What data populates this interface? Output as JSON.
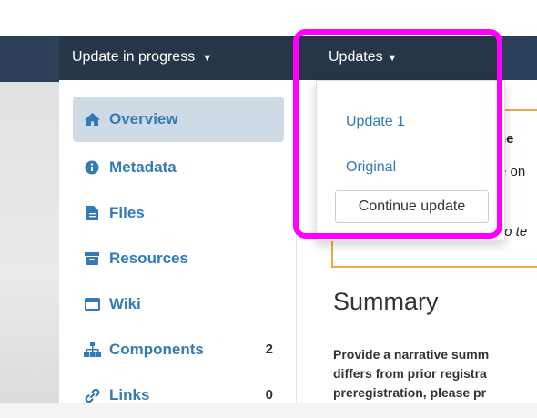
{
  "navbar": {
    "status_dropdown": "Update in progress",
    "updates_dropdown": "Updates"
  },
  "updates_menu": {
    "items": [
      "Update 1",
      "Original"
    ],
    "continue_button": "Continue update"
  },
  "sidebar": {
    "items": [
      {
        "label": "Overview",
        "icon": "home-icon",
        "active": true
      },
      {
        "label": "Metadata",
        "icon": "info-circle-icon"
      },
      {
        "label": "Files",
        "icon": "file-icon"
      },
      {
        "label": "Resources",
        "icon": "archive-icon"
      },
      {
        "label": "Wiki",
        "icon": "window-icon"
      },
      {
        "label": "Components",
        "icon": "sitemap-icon",
        "count": "2"
      },
      {
        "label": "Links",
        "icon": "link-icon",
        "count": "0"
      }
    ]
  },
  "alert": {
    "line1": "the",
    "line2": "e on",
    "line3": "to te"
  },
  "summary": {
    "title": "Summary",
    "lines": [
      "Provide a narrative summ",
      "differs from prior registra",
      "preregistration, please pr"
    ]
  },
  "colors": {
    "navbar_bg": "#263548",
    "link": "#337ab7",
    "active_bg": "#cfdae7",
    "alert_border": "#e8ab48",
    "highlight": "#ff00ff"
  }
}
